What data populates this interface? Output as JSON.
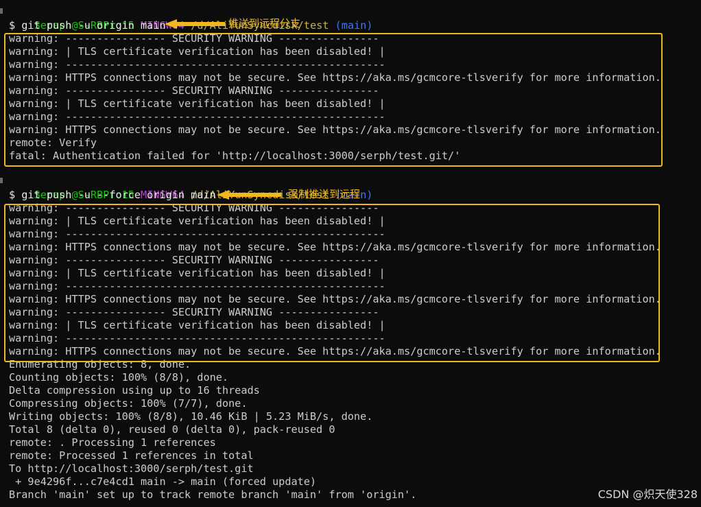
{
  "block1": {
    "prompt": {
      "user": "Seraph@S-RBPro15",
      "shell": "MINGW64",
      "path": "/d/AliYunSyncdisk/test",
      "branch": "(main)"
    },
    "command": "$ git push -u origin main",
    "annotation": "推送到远程分支",
    "output": [
      "warning: ---------------- SECURITY WARNING ----------------",
      "warning: | TLS certificate verification has been disabled! |",
      "warning: ---------------------------------------------------",
      "warning: HTTPS connections may not be secure. See https://aka.ms/gcmcore-tlsverify for more information.",
      "warning: ---------------- SECURITY WARNING ----------------",
      "warning: | TLS certificate verification has been disabled! |",
      "warning: ---------------------------------------------------",
      "warning: HTTPS connections may not be secure. See https://aka.ms/gcmcore-tlsverify for more information.",
      "remote: Verify",
      "fatal: Authentication failed for 'http://localhost:3000/serph/test.git/'"
    ]
  },
  "block2": {
    "prompt": {
      "user": "Seraph@S-RBPro15",
      "shell": "MINGW64",
      "path": "/d/AliYunSyncdisk/test",
      "branch": "(main)"
    },
    "command": "$ git push -u --force origin main",
    "annotation": "强制推送到远程",
    "output": [
      "warning: ---------------- SECURITY WARNING ----------------",
      "warning: | TLS certificate verification has been disabled! |",
      "warning: ---------------------------------------------------",
      "warning: HTTPS connections may not be secure. See https://aka.ms/gcmcore-tlsverify for more information.",
      "warning: ---------------- SECURITY WARNING ----------------",
      "warning: | TLS certificate verification has been disabled! |",
      "warning: ---------------------------------------------------",
      "warning: HTTPS connections may not be secure. See https://aka.ms/gcmcore-tlsverify for more information.",
      "warning: ---------------- SECURITY WARNING ----------------",
      "warning: | TLS certificate verification has been disabled! |",
      "warning: ---------------------------------------------------",
      "warning: HTTPS connections may not be secure. See https://aka.ms/gcmcore-tlsverify for more information."
    ],
    "result": [
      "Enumerating objects: 8, done.",
      "Counting objects: 100% (8/8), done.",
      "Delta compression using up to 16 threads",
      "Compressing objects: 100% (7/7), done.",
      "Writing objects: 100% (8/8), 10.46 KiB | 5.23 MiB/s, done.",
      "Total 8 (delta 0), reused 0 (delta 0), pack-reused 0",
      "remote: . Processing 1 references",
      "remote: Processed 1 references in total",
      "To http://localhost:3000/serph/test.git",
      " + 9e4296f...c7e4cd1 main -> main (forced update)",
      "Branch 'main' set up to track remote branch 'main' from 'origin'."
    ]
  },
  "watermark": "CSDN @炽天使328",
  "colors": {
    "annotation": "#f1b81e",
    "user": "#16c60c",
    "shell": "#b148c6",
    "path": "#c5b34a",
    "branch": "#3b78ff"
  }
}
